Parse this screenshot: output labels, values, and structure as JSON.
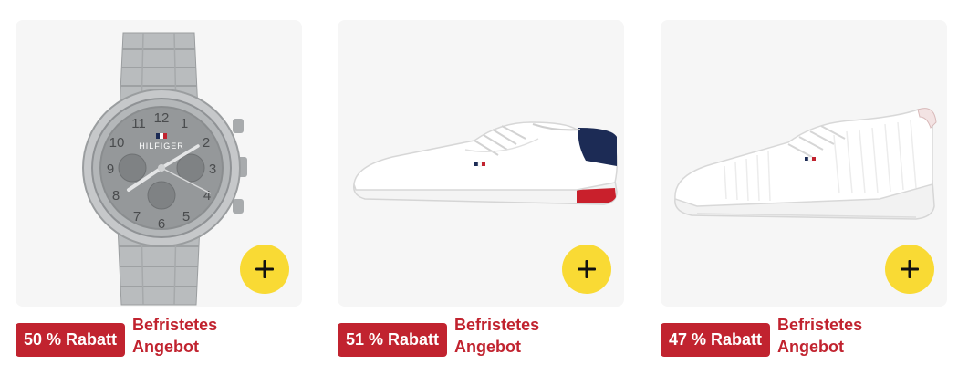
{
  "colors": {
    "card_background": "#f6f6f6",
    "add_button": "#f9da34",
    "deal_red": "#c1232f"
  },
  "products": [
    {
      "image": "silver-chronograph-watch",
      "brand_logo": "HILFIGER",
      "add_icon": "plus-icon",
      "discount_badge": "50 % Rabatt",
      "deal_label": "Befristetes Angebot"
    },
    {
      "image": "white-leather-sneaker",
      "add_icon": "plus-icon",
      "discount_badge": "51 % Rabatt",
      "deal_label": "Befristetes Angebot"
    },
    {
      "image": "white-knit-sneaker",
      "add_icon": "plus-icon",
      "discount_badge": "47 % Rabatt",
      "deal_label": "Befristetes Angebot"
    }
  ]
}
